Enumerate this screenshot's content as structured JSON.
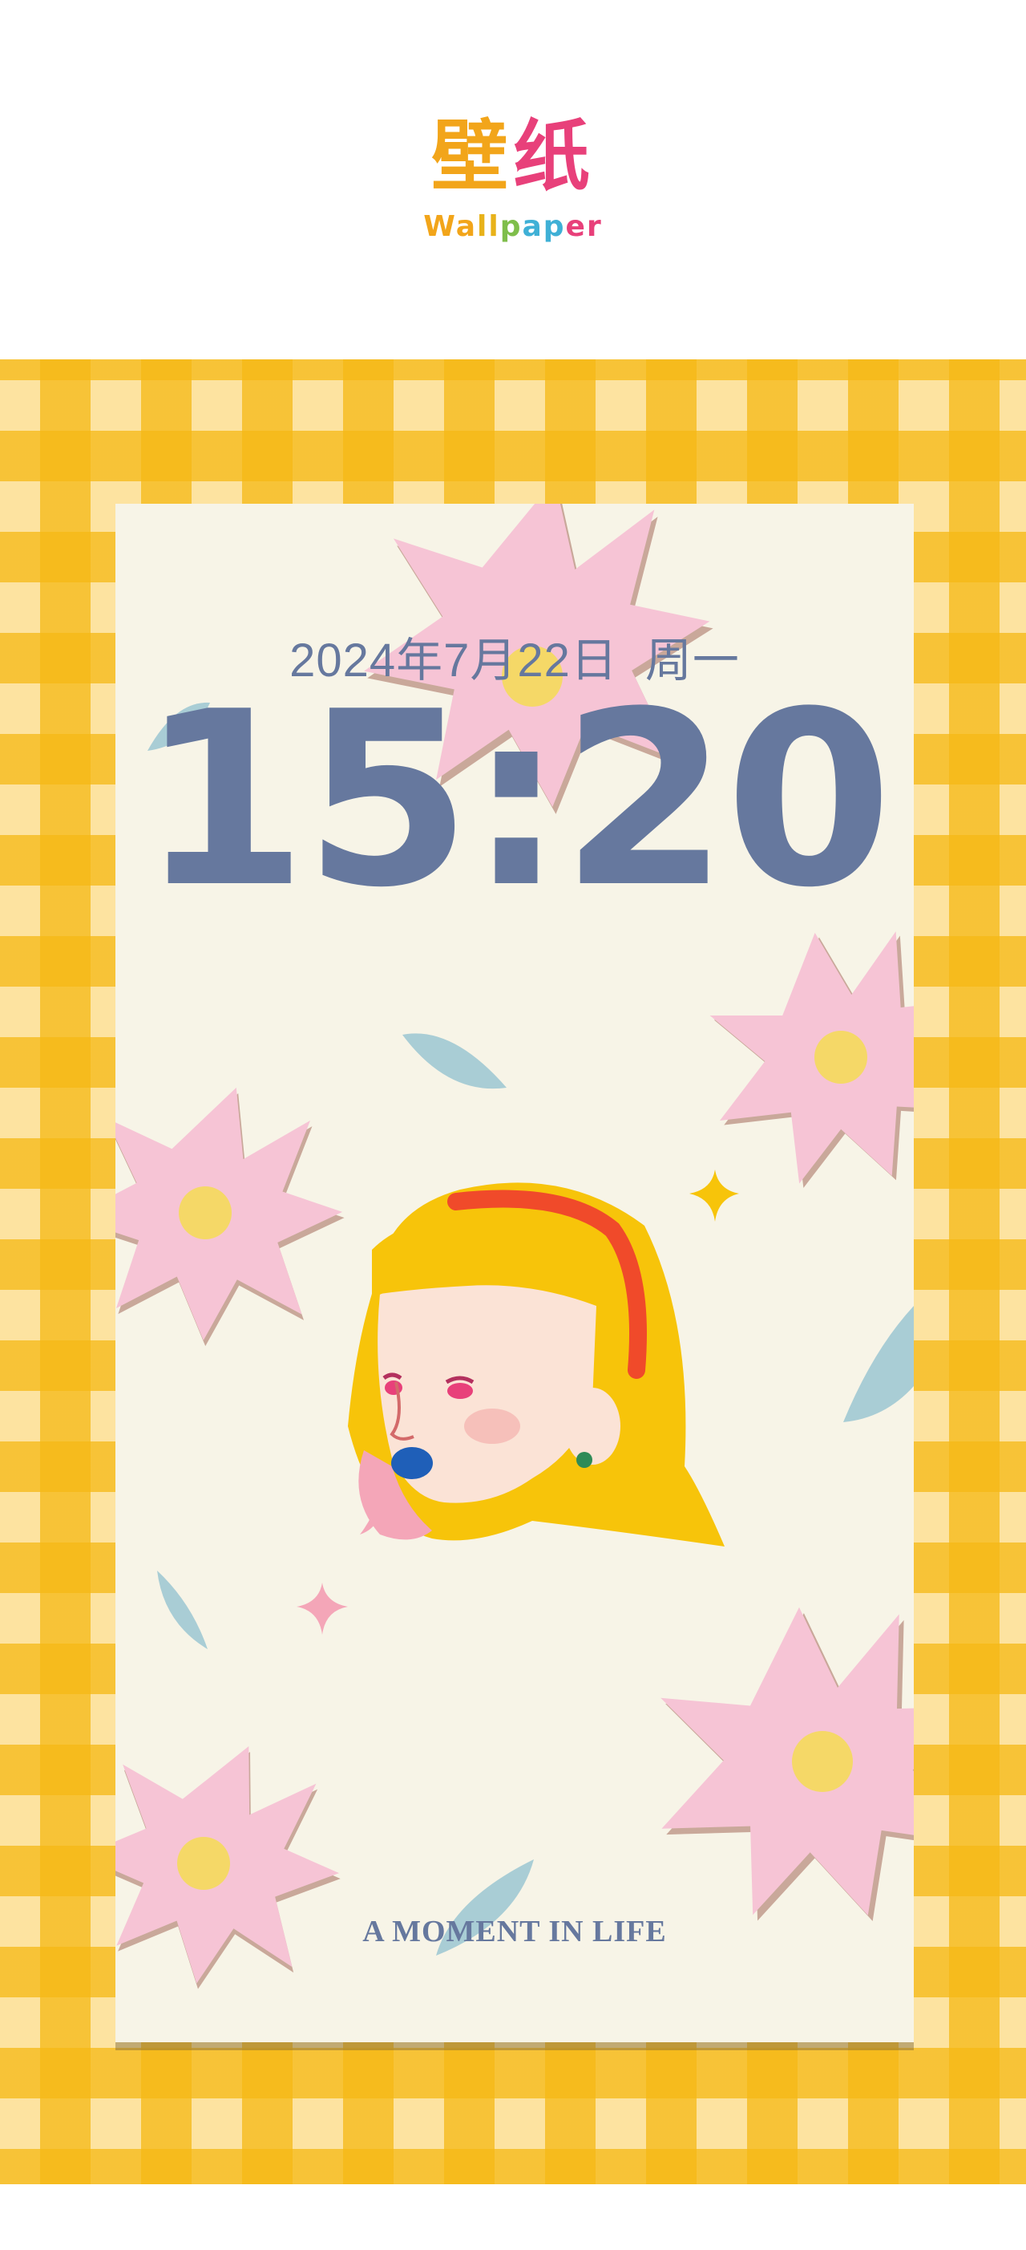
{
  "header": {
    "title_char_1": "壁",
    "title_char_2": "纸",
    "subtitle_letters": [
      "W",
      "a",
      "l",
      "l",
      "p",
      "a",
      "p",
      "e",
      "r"
    ]
  },
  "lockscreen": {
    "date": "2024年7月22日",
    "weekday": "周一",
    "time": "15:20",
    "tagline": "A MOMENT IN LIFE"
  },
  "colors": {
    "gingham_light": "#fde3a0",
    "gingham_dark": "#f6b814",
    "screen_background": "#f7f4e7",
    "text_blue": "#66789e",
    "flower_pink": "#f6c4d5",
    "flower_center": "#f5d867",
    "leaf_blue": "#a9cdd5",
    "hair_yellow": "#f7c40a",
    "headband_red": "#f04a2a"
  },
  "icons": [
    "pink-flower-icon",
    "leaf-icon",
    "sparkle-icon",
    "girl-illustration"
  ]
}
